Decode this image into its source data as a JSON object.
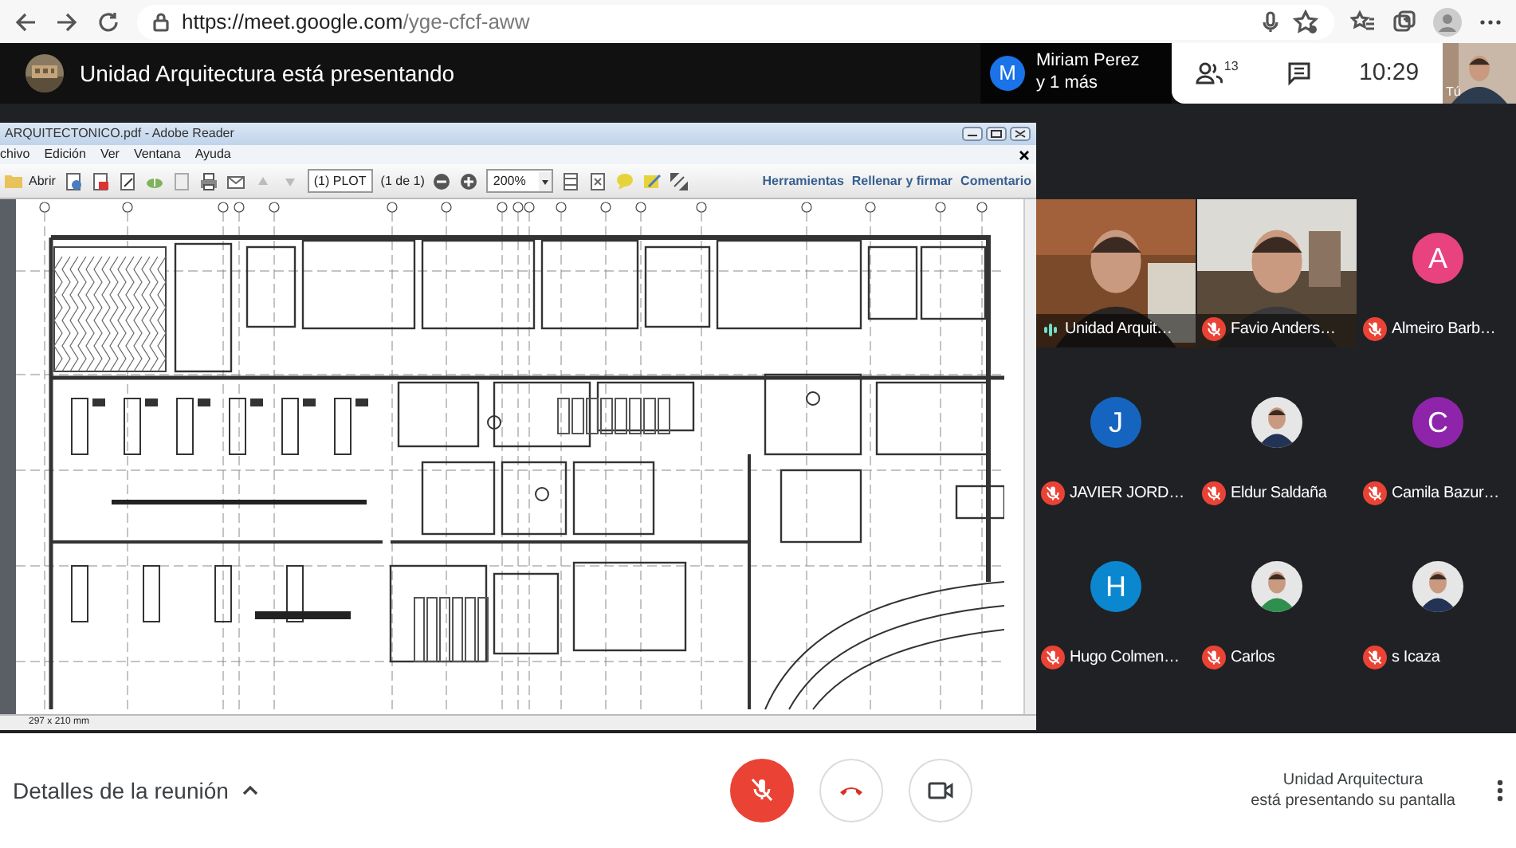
{
  "browser": {
    "url_host": "https://meet.google.com",
    "url_path": "/yge-cfcf-aww"
  },
  "header": {
    "presenter_text": "Unidad Arquitectura está presentando",
    "pinned": {
      "initial": "M",
      "color": "#1a73e8",
      "name": "Miriam Perez",
      "more": "y 1 más"
    },
    "participant_count": "13",
    "time": "10:29",
    "self_label": "Tú"
  },
  "shared_screen": {
    "title": "ARQUITECTONICO.pdf - Adobe Reader",
    "menu": [
      "chivo",
      "Edición",
      "Ver",
      "Ventana",
      "Ayuda"
    ],
    "open_label": "Abrir",
    "page_field": "(1) PLOT",
    "page_count": "(1 de 1)",
    "zoom": "200%",
    "panels": [
      "Herramientas",
      "Rellenar y firmar",
      "Comentario"
    ],
    "page_size": "297 x 210 mm"
  },
  "participants": [
    {
      "name": "Unidad Arquit…",
      "kind": "video",
      "muted": false
    },
    {
      "name": "Favio Anders…",
      "kind": "video",
      "muted": true
    },
    {
      "name": "Almeiro Barb…",
      "kind": "avatar",
      "initial": "A",
      "color": "#e8437e",
      "muted": true
    },
    {
      "name": "JAVIER JORD…",
      "kind": "avatar",
      "initial": "J",
      "color": "#1565c0",
      "muted": true
    },
    {
      "name": "Eldur Saldaña",
      "muted": true
    },
    {
      "name": "Camila Bazur…",
      "kind": "avatar",
      "initial": "C",
      "color": "#8e24aa",
      "muted": true
    },
    {
      "name": "Hugo Colmen…",
      "kind": "avatar",
      "initial": "H",
      "color": "#0b87d0",
      "muted": true
    },
    {
      "name": "Carlos",
      "muted": true
    },
    {
      "name": "s Icaza",
      "muted": true
    }
  ],
  "bottom_bar": {
    "details": "Detalles de la reunión",
    "mic_muted": true,
    "presenting_note": [
      "Unidad Arquitectura",
      "está presentando su pantalla"
    ]
  }
}
